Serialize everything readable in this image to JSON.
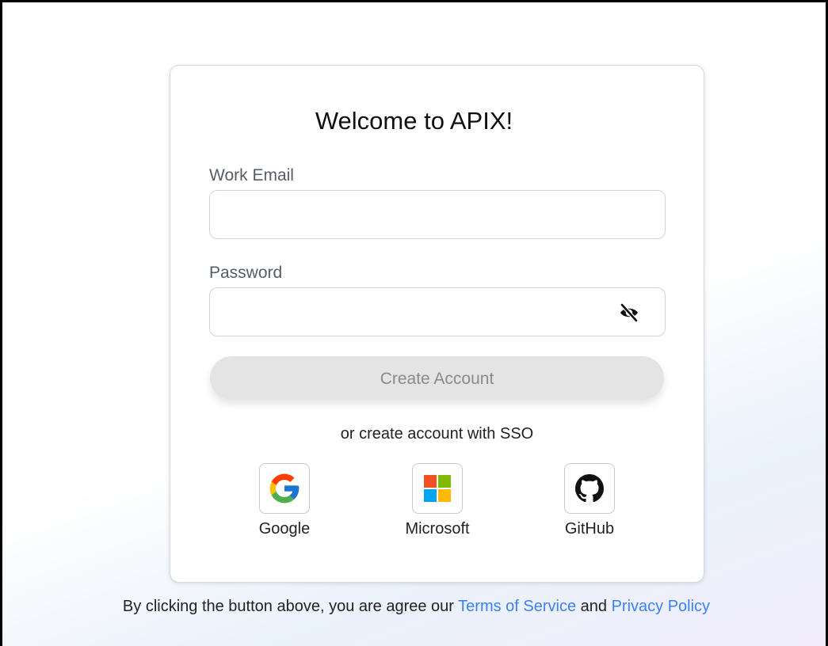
{
  "card": {
    "title": "Welcome to APIX!"
  },
  "form": {
    "email_label": "Work Email",
    "email_value": "",
    "password_label": "Password",
    "password_value": "",
    "create_button_label": "Create Account"
  },
  "sso": {
    "prompt": "or create account with SSO",
    "providers": [
      {
        "label": "Google",
        "icon": "google-icon"
      },
      {
        "label": "Microsoft",
        "icon": "microsoft-icon"
      },
      {
        "label": "GitHub",
        "icon": "github-icon"
      }
    ]
  },
  "footer": {
    "prefix": "By clicking the button above, you are agree our ",
    "terms_link": "Terms of Service",
    "connector": " and ",
    "privacy_link": "Privacy Policy"
  },
  "colors": {
    "link": "#3b82f6",
    "button_disabled_bg": "#e4e4e4",
    "button_disabled_text": "#8a8a8a"
  }
}
